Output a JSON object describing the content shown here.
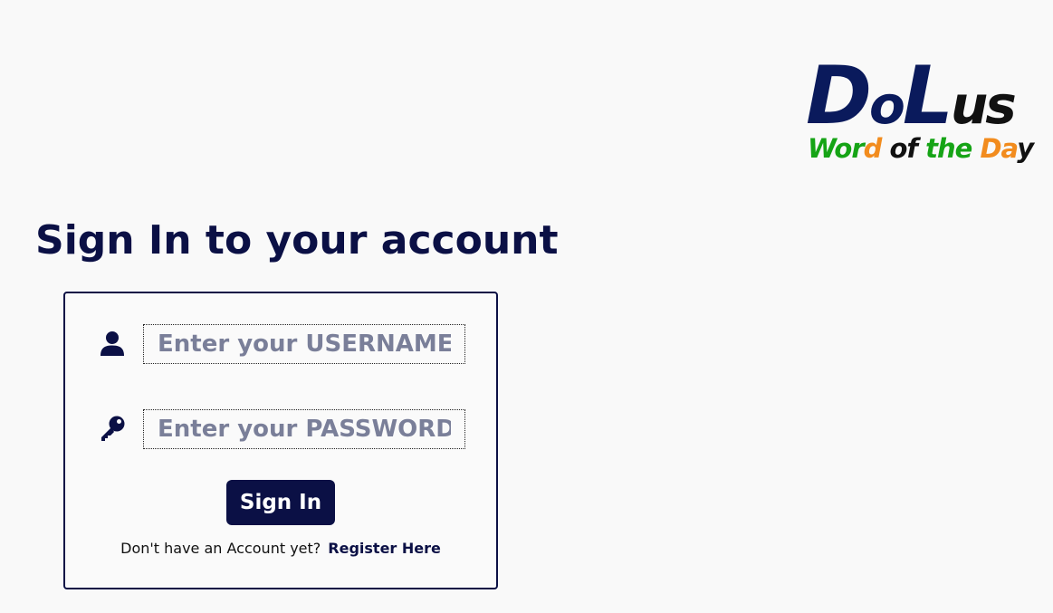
{
  "logo": {
    "main_parts": [
      {
        "text": "D",
        "size": "big",
        "color": "navy"
      },
      {
        "text": "o",
        "size": "small",
        "color": "navy"
      },
      {
        "text": "L",
        "size": "big",
        "color": "navy"
      },
      {
        "text": "us",
        "size": "small",
        "color": "black"
      }
    ],
    "sub_parts": [
      {
        "text": "W",
        "color": "green"
      },
      {
        "text": "or",
        "color": "green"
      },
      {
        "text": "d",
        "color": "orange"
      },
      {
        "text": " of ",
        "color": "black"
      },
      {
        "text": "the",
        "color": "green"
      },
      {
        "text": " ",
        "color": "black"
      },
      {
        "text": "Da",
        "color": "orange"
      },
      {
        "text": "y",
        "color": "black"
      }
    ],
    "colors": {
      "navy": "#0a1a5c",
      "black": "#111111",
      "green": "#16a416",
      "orange": "#f28c1e"
    }
  },
  "title": "Sign In to your account",
  "form": {
    "username": {
      "icon": "user-icon",
      "value": "",
      "placeholder": "Enter your USERNAME"
    },
    "password": {
      "icon": "key-icon",
      "value": "",
      "placeholder": "Enter your PASSWORD"
    },
    "submit_label": "Sign In",
    "register_prompt": "Don't have an Account yet?",
    "register_link": "Register Here"
  },
  "colors": {
    "primary": "#0b1045",
    "background": "#f9f9f9",
    "placeholder": "#7a7f99"
  }
}
